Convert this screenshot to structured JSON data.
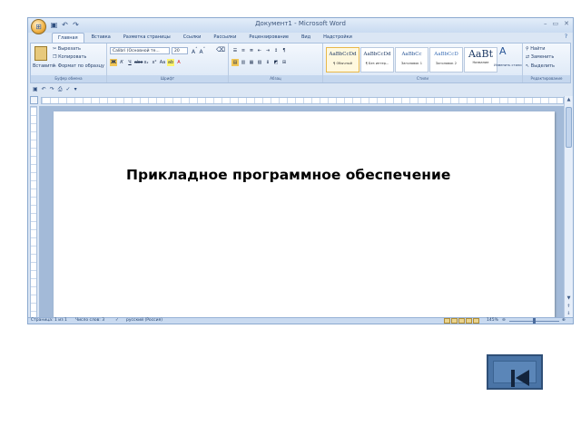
{
  "window": {
    "title": "Документ1 - Microsoft Word",
    "controls": [
      "–",
      "▭",
      "✕"
    ]
  },
  "ribbon": {
    "tabs": [
      "Главная",
      "Вставка",
      "Разметка страницы",
      "Ссылки",
      "Рассылки",
      "Рецензирование",
      "Вид",
      "Надстройки"
    ],
    "active_tab": 0,
    "clipboard": {
      "paste": "Вставить",
      "cut": "Вырезать",
      "copy": "Копировать",
      "format_painter": "Формат по образцу",
      "label": "Буфер обмена"
    },
    "font": {
      "name": "Calibri (Основной те...",
      "size": "20",
      "label": "Шрифт"
    },
    "paragraph": {
      "label": "Абзац"
    },
    "styles": {
      "items": [
        {
          "preview": "AaBbCcDd",
          "name": "¶ Обычный",
          "selected": true
        },
        {
          "preview": "AaBbCcDd",
          "name": "¶ Без интер..."
        },
        {
          "preview": "AaBbCc",
          "name": "Заголовок 1"
        },
        {
          "preview": "AaBbCcD",
          "name": "Заголовок 2"
        },
        {
          "preview": "AaBt",
          "name": "Название"
        }
      ],
      "change": "Изменить стили",
      "label": "Стили"
    },
    "editing": {
      "find": "Найти",
      "replace": "Заменить",
      "select": "Выделить",
      "label": "Редактирование"
    }
  },
  "document": {
    "text": "Прикладное программное обеспечение"
  },
  "statusbar": {
    "page": "Страница: 1 из 1",
    "words": "Число слов: 3",
    "lang": "русский (Россия)",
    "zoom": "145%"
  },
  "nav": {
    "icon": "first-slide-icon"
  }
}
